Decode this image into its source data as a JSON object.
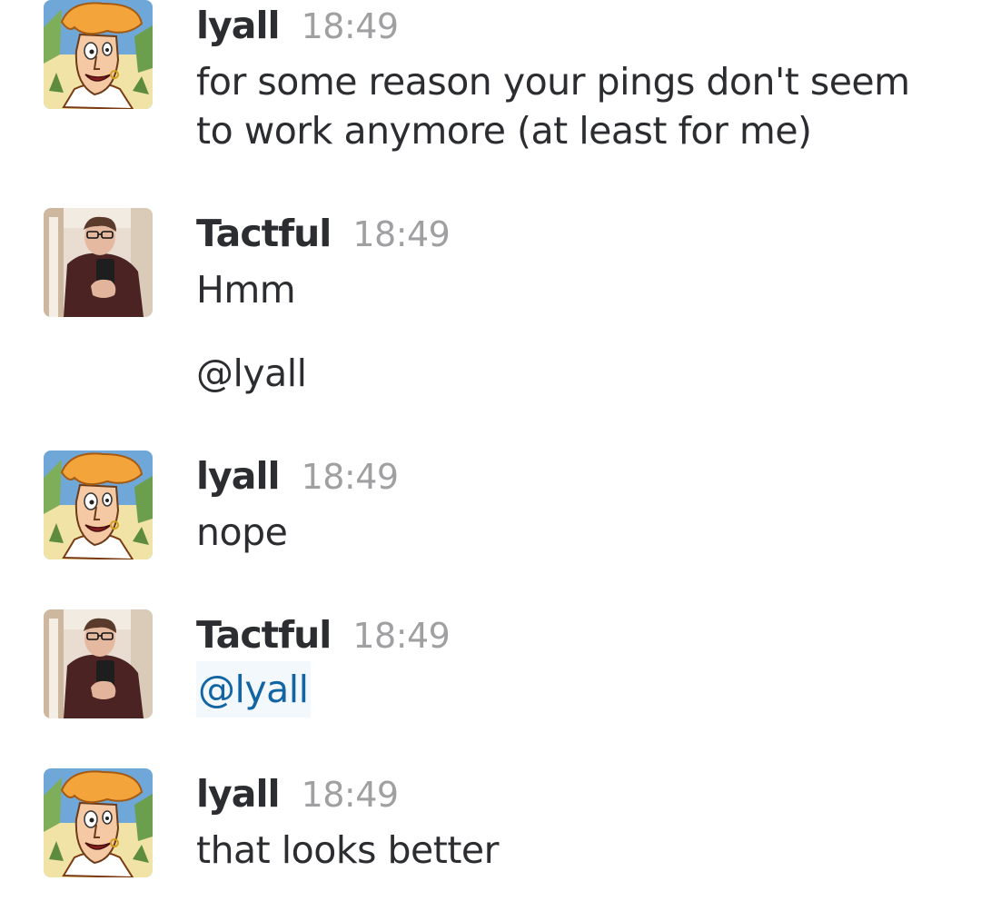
{
  "messages": [
    {
      "author": "lyall",
      "time": "18:49",
      "avatar": "cartoon-pirate-avatar",
      "lines": [
        "for some reason your pings don't seem",
        "to work anymore (at least for me)"
      ]
    },
    {
      "author": "Tactful",
      "time": "18:49",
      "avatar": "mirror-selfie-avatar",
      "lines": [
        "Hmm"
      ],
      "extra": "@lyall"
    },
    {
      "author": "lyall",
      "time": "18:49",
      "avatar": "cartoon-pirate-avatar",
      "lines": [
        "nope"
      ]
    },
    {
      "author": "Tactful",
      "time": "18:49",
      "avatar": "mirror-selfie-avatar",
      "mention": "@lyall"
    },
    {
      "author": "lyall",
      "time": "18:49",
      "avatar": "cartoon-pirate-avatar",
      "lines": [
        "that looks better"
      ]
    }
  ],
  "colors": {
    "text": "#2c2d30",
    "timestamp": "#a0a0a2",
    "mention_text": "#1264a3",
    "mention_bg": "#f2f8fc"
  }
}
